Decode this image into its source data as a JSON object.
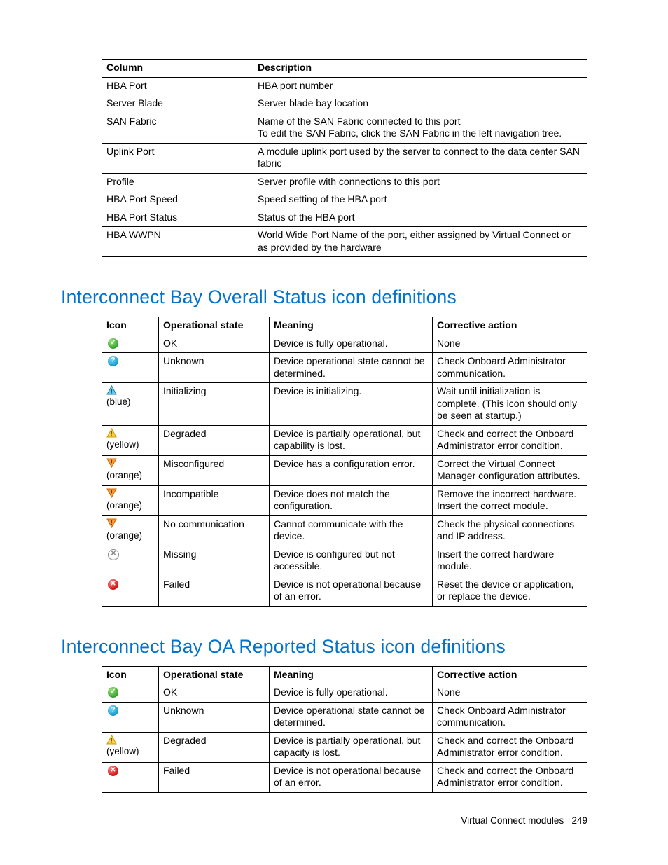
{
  "table1": {
    "headers": [
      "Column",
      "Description"
    ],
    "rows": [
      [
        "HBA Port",
        "HBA port number"
      ],
      [
        "Server Blade",
        "Server blade bay location"
      ],
      [
        "SAN Fabric",
        "Name of the SAN Fabric connected to this port\nTo edit the SAN Fabric, click the SAN Fabric in the left navigation tree."
      ],
      [
        "Uplink Port",
        "A module uplink port used by the server to connect to the data center SAN fabric"
      ],
      [
        "Profile",
        "Server profile with connections to this port"
      ],
      [
        "HBA Port Speed",
        "Speed setting of the HBA port"
      ],
      [
        "HBA Port Status",
        "Status of the HBA port"
      ],
      [
        "HBA WWPN",
        "World Wide Port Name of the port, either assigned by Virtual Connect or as provided by the hardware"
      ]
    ]
  },
  "heading2": "Interconnect Bay Overall Status icon definitions",
  "table2": {
    "headers": [
      "Icon",
      "Operational state",
      "Meaning",
      "Corrective action"
    ],
    "rows": [
      {
        "icon": "ok",
        "iconLabel": "",
        "state": "OK",
        "meaning": "Device is fully operational.",
        "action": "None"
      },
      {
        "icon": "unknown",
        "iconLabel": "",
        "state": "Unknown",
        "meaning": "Device operational state cannot be determined.",
        "action": "Check Onboard Administrator communication."
      },
      {
        "icon": "tri-blue",
        "iconLabel": "(blue)",
        "state": "Initializing",
        "meaning": "Device is initializing.",
        "action": "Wait until initialization is complete. (This icon should only be seen at startup.)"
      },
      {
        "icon": "tri-yellow",
        "iconLabel": "(yellow)",
        "state": "Degraded",
        "meaning": "Device is partially operational, but capability is lost.",
        "action": "Check and correct the Onboard Administrator error condition."
      },
      {
        "icon": "inv-orange",
        "iconLabel": "(orange)",
        "state": "Misconfigured",
        "meaning": "Device has a configuration error.",
        "action": "Correct the Virtual Connect Manager configuration attributes."
      },
      {
        "icon": "inv-orange",
        "iconLabel": "(orange)",
        "state": "Incompatible",
        "meaning": "Device does not match the configuration.",
        "action": "Remove the incorrect hardware. Insert the correct module."
      },
      {
        "icon": "inv-orange",
        "iconLabel": "(orange)",
        "state": "No communication",
        "meaning": "Cannot communicate with the device.",
        "action": "Check the physical connections and IP address."
      },
      {
        "icon": "missing",
        "iconLabel": "",
        "state": "Missing",
        "meaning": "Device is configured but not accessible.",
        "action": "Insert the correct hardware module."
      },
      {
        "icon": "failed",
        "iconLabel": "",
        "state": "Failed",
        "meaning": "Device is not operational because of an error.",
        "action": "Reset the device or application, or replace the device."
      }
    ]
  },
  "heading3": "Interconnect Bay OA Reported Status icon definitions",
  "table3": {
    "headers": [
      "Icon",
      "Operational state",
      "Meaning",
      "Corrective action"
    ],
    "rows": [
      {
        "icon": "ok",
        "iconLabel": "",
        "state": "OK",
        "meaning": "Device is fully operational.",
        "action": "None"
      },
      {
        "icon": "unknown",
        "iconLabel": "",
        "state": "Unknown",
        "meaning": "Device operational state cannot be determined.",
        "action": "Check Onboard Administrator communication."
      },
      {
        "icon": "tri-yellow",
        "iconLabel": "(yellow)",
        "state": "Degraded",
        "meaning": "Device is partially operational, but capacity is lost.",
        "action": "Check and correct the Onboard Administrator error condition."
      },
      {
        "icon": "failed",
        "iconLabel": "",
        "state": "Failed",
        "meaning": "Device is not operational because of an error.",
        "action": "Check and correct the Onboard Administrator error condition."
      }
    ]
  },
  "footer": {
    "section": "Virtual Connect modules",
    "page": "249"
  },
  "icons": {
    "ok": "ok-icon",
    "unknown": "question-icon",
    "tri-blue": "triangle-exclaim-blue-icon",
    "tri-yellow": "triangle-exclaim-yellow-icon",
    "inv-orange": "inverted-triangle-exclaim-orange-icon",
    "missing": "x-outline-icon",
    "failed": "x-circle-red-icon"
  }
}
